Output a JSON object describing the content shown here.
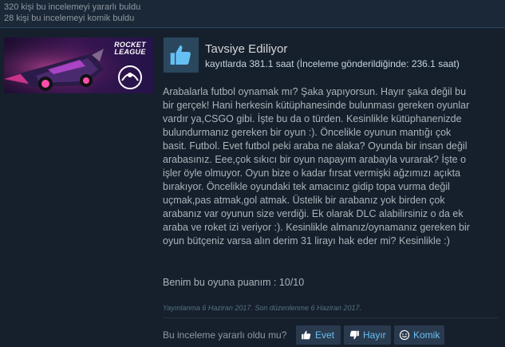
{
  "helpful": {
    "line1": "320 kişi bu incelemeyi yararlı buldu",
    "line2": "28 kişi bu incelemeyi komik buldu"
  },
  "game": {
    "logo_text_line1": "ROCKET",
    "logo_text_line2": "LEAGUE",
    "accent": "#f04aa0"
  },
  "review": {
    "recommendation": "Tavsiye Ediliyor",
    "hours": "kayıtlarda 381.1 saat (İnceleme gönderildiğinde: 236.1 saat)",
    "thumb_icon": "thumbs-up-icon",
    "lines": [
      "Arabalarla futbol oynamak mı? Şaka yapıyorsun. Hayır şaka değil bu",
      "bir gerçek! Hani herkesin kütüphanesinde bulunması gereken oyunlar",
      "vardır ya,CSGO gibi. İşte bu da o türden. Kesinlikle kütüphanenizde",
      "bulundurmanız gereken bir oyun :). Öncelikle oyunun mantığı çok",
      "basit. Futbol. Evet futbol peki araba ne alaka? Oyunda bir insan değil",
      "arabasınız. Eee,çok sıkıcı bir oyun napayım arabayla vurarak? İşte o",
      "işler öyle olmuyor. Oyun bize o kadar fırsat vermişki ağzımızı açıkta",
      "bırakıyor. Öncelikle oyundaki tek amacınız gidip topa vurma değil",
      "uçmak,pas atmak,gol atmak. Üstelik bir arabanız yok birden çok",
      "arabanız var oyunun size verdiği. Ek olarak DLC alabilirsiniz o da ek",
      "araba ve roket izi veriyor :). Kesinlikle almanız/oynamanız gereken bir",
      "oyun bütçeniz varsa alın derim 31 lirayı hak eder mi? Kesinlikle :)"
    ],
    "score": "Benim bu oyuna puanım : 10/10",
    "posted": "Yayınlanma 6 Haziran 2017. Son düzenlenme 6 Haziran 2017."
  },
  "vote": {
    "question": "Bu inceleme yararlı oldu mu?",
    "yes_label": "Evet",
    "no_label": "Hayır",
    "funny_label": "Komik",
    "yes_icon": "thumbs-up-icon",
    "no_icon": "thumbs-down-icon",
    "funny_icon": "smiley-icon"
  }
}
